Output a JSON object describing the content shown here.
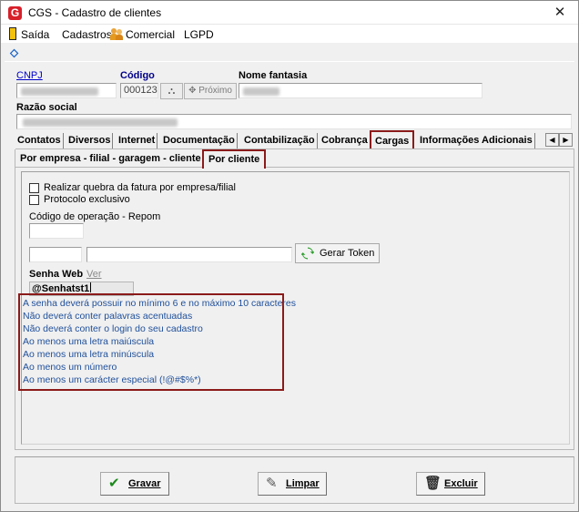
{
  "window": {
    "title": "CGS - Cadastro de clientes",
    "app_icon": "G",
    "close_glyph": "✕"
  },
  "menu": {
    "items": [
      "Saída",
      "Cadastros",
      "Comercial",
      "LGPD"
    ]
  },
  "header": {
    "cnpj_label": "CNPJ",
    "codigo_label": "Código",
    "codigo_value": "000123",
    "proximo_label": "Próximo",
    "nome_fantasia_label": "Nome fantasia",
    "razao_social_label": "Razão social"
  },
  "tabs": [
    {
      "label": "Contatos",
      "selected": false
    },
    {
      "label": "Diversos",
      "selected": false
    },
    {
      "label": "Internet",
      "selected": false
    },
    {
      "label": "Documentação",
      "selected": false
    },
    {
      "label": "Contabilização",
      "selected": false
    },
    {
      "label": "Cobrança",
      "selected": false
    },
    {
      "label": "Cargas",
      "selected": true
    },
    {
      "label": "Informações Adicionais",
      "selected": false
    }
  ],
  "subtabs": [
    {
      "label": "Por empresa - filial - garagem - cliente",
      "selected": false
    },
    {
      "label": "Por cliente",
      "selected": true
    }
  ],
  "cargas": {
    "checkbox_quebra": "Realizar quebra da fatura por empresa/filial",
    "checkbox_protocolo": "Protocolo exclusivo",
    "codigo_operacao_label": "Código de operação - Repom",
    "gerar_token_label": "Gerar Token",
    "senha_web_label": "Senha Web",
    "ver_label": "Ver",
    "senha_value": "@Senhatst1",
    "rules": [
      "A senha deverá possuir no mínimo 6 e no máximo 10 caracteres",
      "Não deverá conter palavras acentuadas",
      "Não deverá conter o login do seu cadastro",
      "Ao menos uma letra maiúscula",
      "Ao menos uma letra minúscula",
      "Ao menos um número",
      "Ao menos um carácter especial (!@#$%*)"
    ]
  },
  "footer": {
    "gravar_label": "Gravar",
    "limpar_label": "Limpar",
    "excluir_label": "Excluir"
  },
  "colors": {
    "highlight_border": "#8b1a1a",
    "rule_text": "#1f4f9a",
    "app_red": "#d7202a"
  }
}
